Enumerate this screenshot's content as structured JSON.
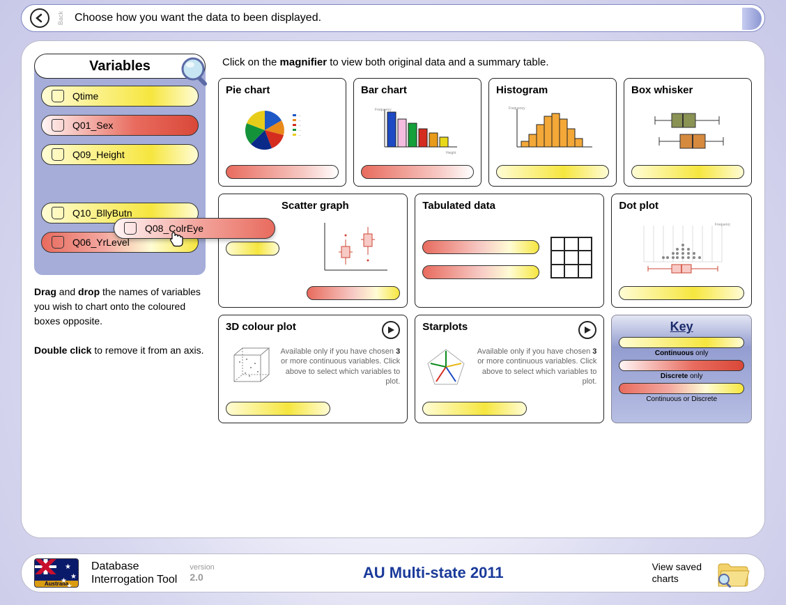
{
  "topbar": {
    "back_label": "Back",
    "instruction": "Choose how you want the data to been displayed."
  },
  "sidebar": {
    "header": "Variables",
    "variables": [
      {
        "name": "Qtime",
        "style": "yellow"
      },
      {
        "name": "Q01_Sex",
        "style": "red"
      },
      {
        "name": "Q09_Height",
        "style": "yellow"
      },
      {
        "name": "",
        "style": "gap"
      },
      {
        "name": "Q10_BllyButn",
        "style": "yellow"
      },
      {
        "name": "Q06_YrLevel",
        "style": "mixed"
      }
    ],
    "dragging": {
      "name": "Q08_ColrEye"
    },
    "hint_html": "<b>Drag</b> and <b>drop</b> the names of variables you wish to chart onto the coloured boxes opposite.<br><br><b>Double click</b> to remove it from an axis."
  },
  "right": {
    "magnifier_hint_pre": "Click on the ",
    "magnifier_hint_bold": "magnifier",
    "magnifier_hint_post": " to view both original data and a summary table.",
    "cards": {
      "pie": "Pie chart",
      "bar": "Bar chart",
      "hist": "Histogram",
      "box": "Box whisker",
      "scatter": "Scatter graph",
      "tab": "Tabulated data",
      "dot": "Dot plot",
      "colour3d": "3D colour plot",
      "star": "Starplots"
    },
    "avail_pre": "Available only if you have chosen ",
    "avail_num": "3",
    "avail_post": " or more continuous variables. Click above to select which variables to plot."
  },
  "key": {
    "title": "Key",
    "cont": "Continuous",
    "disc": "Discrete",
    "only": " only",
    "either": "Continuous or Discrete"
  },
  "footer": {
    "flag_label": "Australia",
    "tool_name_l1": "Database",
    "tool_name_l2": "Interrogation Tool",
    "version_label": "version",
    "version_num": "2.0",
    "database_title": "AU Multi-state 2011",
    "view_saved_l1": "View saved",
    "view_saved_l2": "charts"
  }
}
